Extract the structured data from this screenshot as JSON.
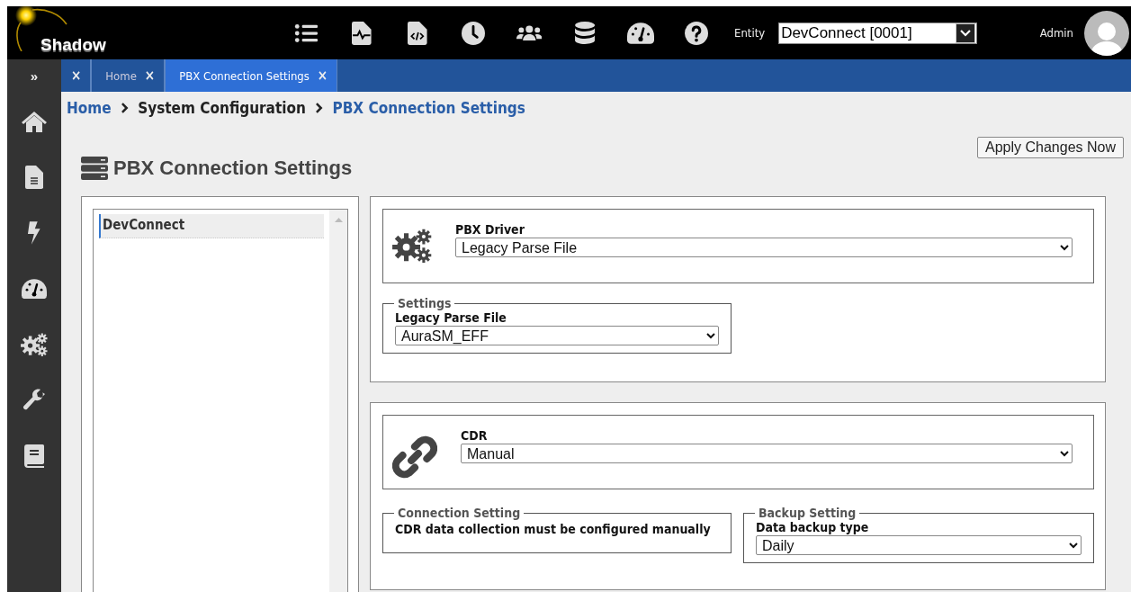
{
  "header": {
    "logo_text": "Shadow",
    "entity_label": "Entity",
    "entity_value": "DevConnect [0001]",
    "user": "Admin"
  },
  "sidebar": {
    "toggle": "»"
  },
  "tabs": [
    {
      "close": "×",
      "selected": false
    },
    {
      "label": "Home",
      "close": "×",
      "selected": false
    },
    {
      "label": "PBX Connection Settings",
      "close": "×",
      "selected": true
    }
  ],
  "breadcrumb": [
    {
      "label": "Home",
      "kind": "link"
    },
    {
      "label": "System Configuration",
      "kind": "plain"
    },
    {
      "label": "PBX Connection Settings",
      "kind": "link"
    }
  ],
  "page_title": "PBX Connection Settings",
  "apply_button": "Apply Changes Now",
  "connection_list": [
    {
      "label": "DevConnect",
      "selected": true
    }
  ],
  "driver": {
    "label": "PBX Driver",
    "value": "Legacy Parse File",
    "settings": {
      "legend": "Settings",
      "label": "Legacy Parse File",
      "value": "AuraSM_EFF"
    }
  },
  "cdr": {
    "label": "CDR",
    "value": "Manual",
    "connection_setting": {
      "legend": "Connection Setting",
      "message": "CDR data collection must be configured manually"
    },
    "backup_setting": {
      "legend": "Backup Setting",
      "label": "Data backup type",
      "value": "Daily"
    }
  }
}
